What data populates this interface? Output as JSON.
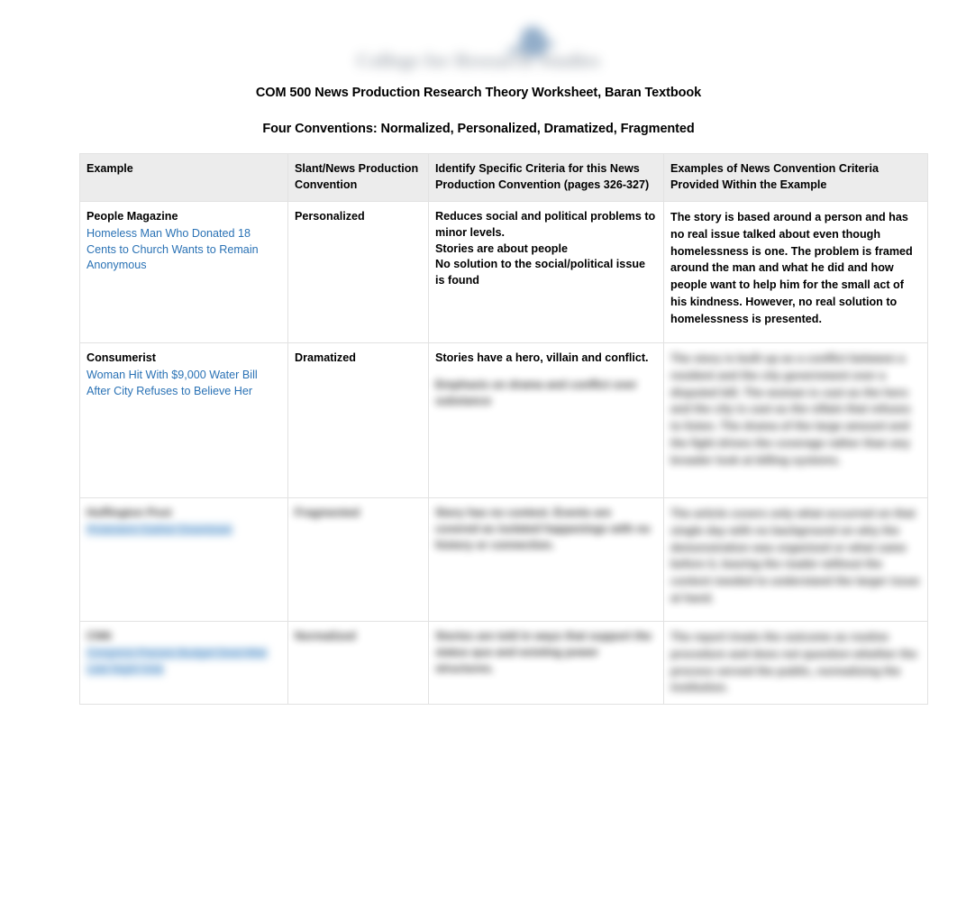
{
  "document": {
    "logo": {
      "name": "college-logo",
      "wordmark_approx": "College for Research Studies",
      "legible": false
    },
    "title_line_1": "COM 500 News Production Research Theory Worksheet, Baran Textbook",
    "title_line_2": "Four Conventions: Normalized, Personalized, Dramatized, Fragmented"
  },
  "table": {
    "headers": [
      "Example",
      "Slant/News Production Convention",
      "Identify Specific Criteria for this News Production Convention (pages 326-327)",
      "Examples of News Convention Criteria Provided Within the Example"
    ],
    "rows": [
      {
        "example_source": "People Magazine",
        "example_link": "Homeless Man Who Donated 18 Cents to Church Wants to Remain Anonymous",
        "slant": "Personalized",
        "criteria": "Reduces social and political problems to minor levels.\nStories are about people\nNo solution to the social/political issue is found",
        "examples": "The story is based around a person and has no real issue talked about even though homelessness is one. The problem is framed around the man and what he did and how people want to help him for the small act of his kindness. However, no real solution to homelessness is presented.",
        "redacted": {
          "example_source": false,
          "example_link": false,
          "slant": false,
          "criteria": false,
          "examples": false
        }
      },
      {
        "example_source": "Consumerist",
        "example_link": "Woman Hit With $9,000 Water Bill After City Refuses to Believe Her",
        "slant": "Dramatized",
        "criteria": "Stories have a hero, villain and conflict.",
        "criteria_extra_illegible": "Emphasis on drama and conflict over substance",
        "examples": "Illegible blurred paragraph text",
        "redacted": {
          "example_source": false,
          "example_link": false,
          "slant": false,
          "criteria": false,
          "criteria_extra": true,
          "examples": true
        }
      },
      {
        "example_source": "Illegible source name",
        "example_link": "Illegible highlighted headline link",
        "slant": "Fragmented",
        "criteria": "Illegible blurred criteria text",
        "examples": "Illegible blurred paragraph text",
        "redacted": {
          "example_source": true,
          "example_link": true,
          "slant": true,
          "criteria": true,
          "examples": true
        }
      },
      {
        "example_source": "CNN",
        "example_link": "Illegible highlighted headline link",
        "slant": "Normalized",
        "criteria": "Illegible blurred criteria text",
        "examples": "Illegible blurred paragraph text",
        "redacted": {
          "example_source": true,
          "example_link": true,
          "slant": true,
          "criteria": true,
          "examples": true
        }
      }
    ]
  },
  "colors": {
    "link": "#2a72b5",
    "highlight": "#bdd7ee",
    "header_background": "#ececec",
    "border": "#e2e2e2",
    "text": "#000000"
  }
}
